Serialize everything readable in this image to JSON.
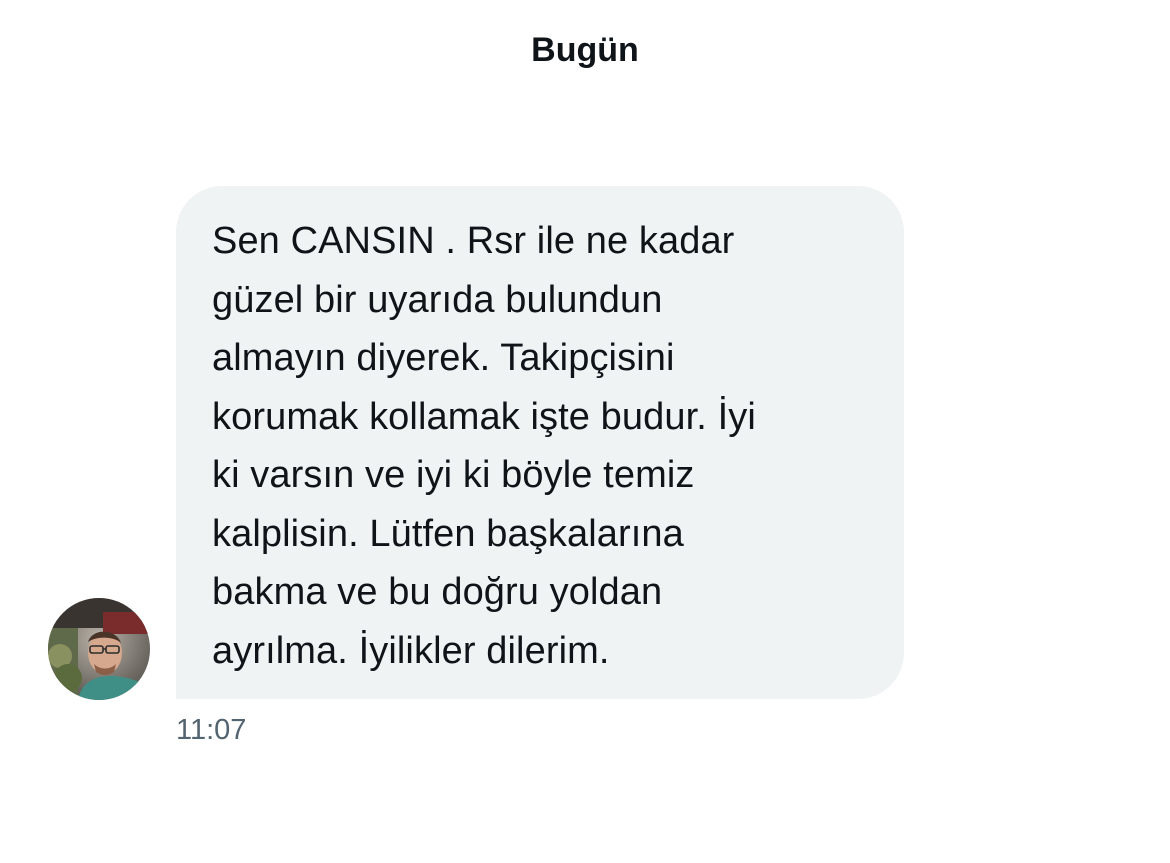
{
  "conversation": {
    "date_label": "Bugün",
    "message": {
      "text": "Sen CANSIN . Rsr ile ne kadar\ngüzel bir uyarıda bulundun\nalmayın diyerek. Takipçisini\nkorumak kollamak işte budur. İyi\nki varsın ve iyi ki böyle temiz\nkalplisin. Lütfen başkalarına\nbakma ve bu doğru yoldan\nayrılma. İyilikler dilerim.",
      "time": "11:07",
      "sender_avatar_icon": "user-avatar-photo"
    }
  },
  "colors": {
    "bubble_background": "#eff3f4",
    "text_primary": "#0f1419",
    "text_secondary": "#536471"
  }
}
